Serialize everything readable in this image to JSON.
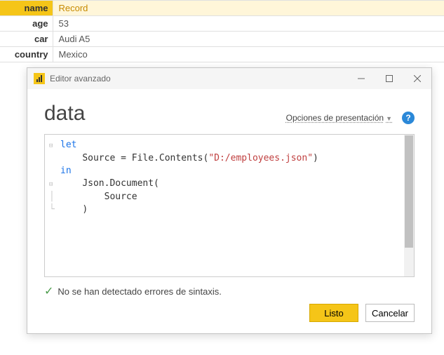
{
  "table": {
    "rows": [
      {
        "label": "name",
        "value": "Record",
        "highlighted": true
      },
      {
        "label": "age",
        "value": "53"
      },
      {
        "label": "car",
        "value": "Audi A5"
      },
      {
        "label": "country",
        "value": "Mexico"
      }
    ]
  },
  "dialog": {
    "title": "Editor avanzado",
    "query_name": "data",
    "display_options_label": "Opciones de presentación",
    "help_label": "?",
    "code": {
      "line1_kw": "let",
      "line2_indent": "    ",
      "line2_fn": "Source = File.Contents(",
      "line2_str": "\"D:/employees.json\"",
      "line2_close": ")",
      "line3_kw": "in",
      "line4_indent": "    ",
      "line4_fn": "Json.Document(",
      "line5_indent": "        ",
      "line5_txt": "Source",
      "line6_indent": "    ",
      "line6_txt": ")"
    },
    "status_ok": "No se han detectado errores de sintaxis.",
    "btn_ok": "Listo",
    "btn_cancel": "Cancelar"
  }
}
